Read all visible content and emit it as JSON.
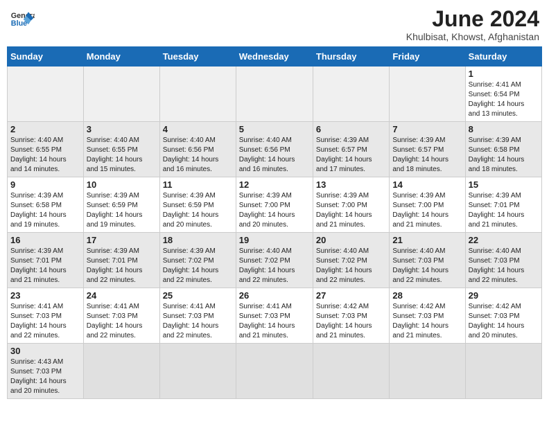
{
  "header": {
    "logo_general": "General",
    "logo_blue": "Blue",
    "month_title": "June 2024",
    "subtitle": "Khulbisat, Khowst, Afghanistan"
  },
  "days_of_week": [
    "Sunday",
    "Monday",
    "Tuesday",
    "Wednesday",
    "Thursday",
    "Friday",
    "Saturday"
  ],
  "weeks": [
    [
      {
        "day": "",
        "info": ""
      },
      {
        "day": "",
        "info": ""
      },
      {
        "day": "",
        "info": ""
      },
      {
        "day": "",
        "info": ""
      },
      {
        "day": "",
        "info": ""
      },
      {
        "day": "",
        "info": ""
      },
      {
        "day": "1",
        "info": "Sunrise: 4:41 AM\nSunset: 6:54 PM\nDaylight: 14 hours\nand 13 minutes."
      }
    ],
    [
      {
        "day": "2",
        "info": "Sunrise: 4:40 AM\nSunset: 6:55 PM\nDaylight: 14 hours\nand 14 minutes."
      },
      {
        "day": "3",
        "info": "Sunrise: 4:40 AM\nSunset: 6:55 PM\nDaylight: 14 hours\nand 15 minutes."
      },
      {
        "day": "4",
        "info": "Sunrise: 4:40 AM\nSunset: 6:56 PM\nDaylight: 14 hours\nand 16 minutes."
      },
      {
        "day": "5",
        "info": "Sunrise: 4:40 AM\nSunset: 6:56 PM\nDaylight: 14 hours\nand 16 minutes."
      },
      {
        "day": "6",
        "info": "Sunrise: 4:39 AM\nSunset: 6:57 PM\nDaylight: 14 hours\nand 17 minutes."
      },
      {
        "day": "7",
        "info": "Sunrise: 4:39 AM\nSunset: 6:57 PM\nDaylight: 14 hours\nand 18 minutes."
      },
      {
        "day": "8",
        "info": "Sunrise: 4:39 AM\nSunset: 6:58 PM\nDaylight: 14 hours\nand 18 minutes."
      }
    ],
    [
      {
        "day": "9",
        "info": "Sunrise: 4:39 AM\nSunset: 6:58 PM\nDaylight: 14 hours\nand 19 minutes."
      },
      {
        "day": "10",
        "info": "Sunrise: 4:39 AM\nSunset: 6:59 PM\nDaylight: 14 hours\nand 19 minutes."
      },
      {
        "day": "11",
        "info": "Sunrise: 4:39 AM\nSunset: 6:59 PM\nDaylight: 14 hours\nand 20 minutes."
      },
      {
        "day": "12",
        "info": "Sunrise: 4:39 AM\nSunset: 7:00 PM\nDaylight: 14 hours\nand 20 minutes."
      },
      {
        "day": "13",
        "info": "Sunrise: 4:39 AM\nSunset: 7:00 PM\nDaylight: 14 hours\nand 21 minutes."
      },
      {
        "day": "14",
        "info": "Sunrise: 4:39 AM\nSunset: 7:00 PM\nDaylight: 14 hours\nand 21 minutes."
      },
      {
        "day": "15",
        "info": "Sunrise: 4:39 AM\nSunset: 7:01 PM\nDaylight: 14 hours\nand 21 minutes."
      }
    ],
    [
      {
        "day": "16",
        "info": "Sunrise: 4:39 AM\nSunset: 7:01 PM\nDaylight: 14 hours\nand 21 minutes."
      },
      {
        "day": "17",
        "info": "Sunrise: 4:39 AM\nSunset: 7:01 PM\nDaylight: 14 hours\nand 22 minutes."
      },
      {
        "day": "18",
        "info": "Sunrise: 4:39 AM\nSunset: 7:02 PM\nDaylight: 14 hours\nand 22 minutes."
      },
      {
        "day": "19",
        "info": "Sunrise: 4:40 AM\nSunset: 7:02 PM\nDaylight: 14 hours\nand 22 minutes."
      },
      {
        "day": "20",
        "info": "Sunrise: 4:40 AM\nSunset: 7:02 PM\nDaylight: 14 hours\nand 22 minutes."
      },
      {
        "day": "21",
        "info": "Sunrise: 4:40 AM\nSunset: 7:03 PM\nDaylight: 14 hours\nand 22 minutes."
      },
      {
        "day": "22",
        "info": "Sunrise: 4:40 AM\nSunset: 7:03 PM\nDaylight: 14 hours\nand 22 minutes."
      }
    ],
    [
      {
        "day": "23",
        "info": "Sunrise: 4:41 AM\nSunset: 7:03 PM\nDaylight: 14 hours\nand 22 minutes."
      },
      {
        "day": "24",
        "info": "Sunrise: 4:41 AM\nSunset: 7:03 PM\nDaylight: 14 hours\nand 22 minutes."
      },
      {
        "day": "25",
        "info": "Sunrise: 4:41 AM\nSunset: 7:03 PM\nDaylight: 14 hours\nand 22 minutes."
      },
      {
        "day": "26",
        "info": "Sunrise: 4:41 AM\nSunset: 7:03 PM\nDaylight: 14 hours\nand 21 minutes."
      },
      {
        "day": "27",
        "info": "Sunrise: 4:42 AM\nSunset: 7:03 PM\nDaylight: 14 hours\nand 21 minutes."
      },
      {
        "day": "28",
        "info": "Sunrise: 4:42 AM\nSunset: 7:03 PM\nDaylight: 14 hours\nand 21 minutes."
      },
      {
        "day": "29",
        "info": "Sunrise: 4:42 AM\nSunset: 7:03 PM\nDaylight: 14 hours\nand 20 minutes."
      }
    ],
    [
      {
        "day": "30",
        "info": "Sunrise: 4:43 AM\nSunset: 7:03 PM\nDaylight: 14 hours\nand 20 minutes."
      },
      {
        "day": "",
        "info": ""
      },
      {
        "day": "",
        "info": ""
      },
      {
        "day": "",
        "info": ""
      },
      {
        "day": "",
        "info": ""
      },
      {
        "day": "",
        "info": ""
      },
      {
        "day": "",
        "info": ""
      }
    ]
  ]
}
